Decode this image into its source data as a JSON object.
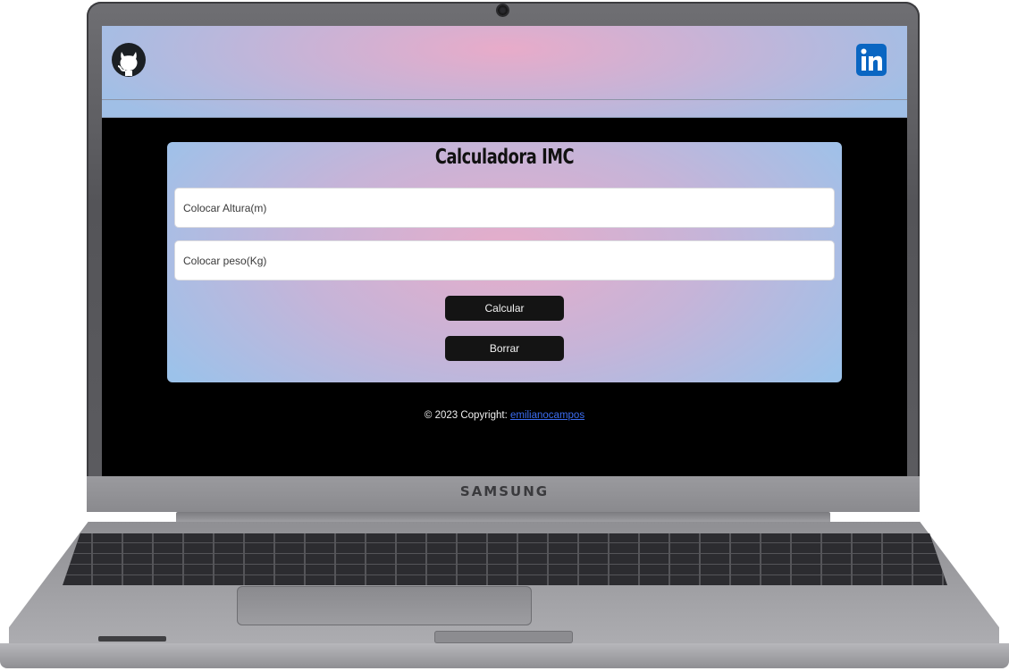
{
  "device": {
    "brand": "SAMSUNG"
  },
  "navbar": {
    "left_icon": "github-icon",
    "right_icon": "linkedin-icon"
  },
  "calculator": {
    "title": "Calculadora IMC",
    "height_placeholder": "Colocar Altura(m)",
    "weight_placeholder": "Colocar peso(Kg)",
    "calculate_label": "Calcular",
    "clear_label": "Borrar"
  },
  "footer": {
    "text": "© 2023 Copyright: ",
    "link_text": "emilianocampos"
  },
  "colors": {
    "screen_background": "#000000",
    "gradient_pink": "#e8abc9",
    "gradient_blue": "#9cc2ea",
    "button_background": "#141414",
    "link": "#3b6cf0",
    "linkedin_blue": "#0a66c2"
  }
}
